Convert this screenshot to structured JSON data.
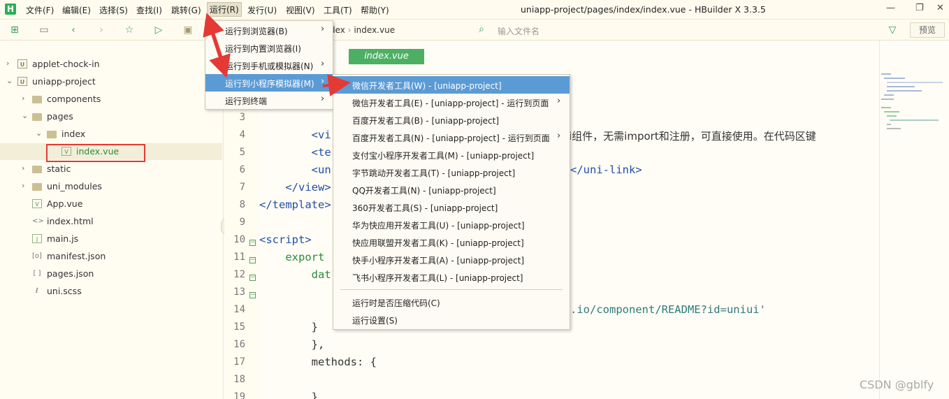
{
  "app": {
    "logo": "H",
    "window_title": "uniapp-project/pages/index/index.vue - HBuilder X 3.3.5"
  },
  "menubar": {
    "items": [
      "文件(F)",
      "编辑(E)",
      "选择(S)",
      "查找(I)",
      "跳转(G)",
      "运行(R)",
      "发行(U)",
      "视图(V)",
      "工具(T)",
      "帮助(Y)"
    ],
    "active": "运行(R)"
  },
  "window_controls": {
    "minimize": "—",
    "maximize": "❐",
    "close": "✕"
  },
  "toolbar": {
    "breadcrumb": [
      "dex",
      "index.vue"
    ],
    "search_placeholder": "输入文件名",
    "preview_label": "预览"
  },
  "sidebar": {
    "items": [
      {
        "label": "applet-chock-in",
        "type": "project",
        "expanded": false
      },
      {
        "label": "uniapp-project",
        "type": "project",
        "expanded": true
      },
      {
        "label": "components",
        "type": "folder",
        "expanded": false
      },
      {
        "label": "pages",
        "type": "folder",
        "expanded": true
      },
      {
        "label": "index",
        "type": "folder",
        "expanded": true
      },
      {
        "label": "index.vue",
        "type": "vue",
        "selected": true
      },
      {
        "label": "static",
        "type": "folder",
        "expanded": false
      },
      {
        "label": "uni_modules",
        "type": "folder",
        "expanded": false
      },
      {
        "label": "App.vue",
        "type": "vue"
      },
      {
        "label": "index.html",
        "type": "code"
      },
      {
        "label": "main.js",
        "type": "js"
      },
      {
        "label": "manifest.json",
        "type": "json"
      },
      {
        "label": "pages.json",
        "type": "json"
      },
      {
        "label": "uni.scss",
        "type": "scss"
      }
    ]
  },
  "editor": {
    "tab_label": "index.vue",
    "line_numbers": [
      "3",
      "4",
      "5",
      "6",
      "7",
      "8",
      "9",
      "10",
      "11",
      "12",
      "13",
      "14",
      "15",
      "16",
      "17",
      "18",
      "19"
    ],
    "lines": [
      "",
      "        <vi",
      "        <te",
      "        <un",
      "    </view>",
      "</template>",
      "",
      "<script>",
      "    export",
      "        dat",
      "",
      "",
      "        }",
      "        },",
      "        methods: {",
      "",
      "        }"
    ],
    "tail_line4": "i组件，无需import和注册，可直接使用。在代码区键",
    "tail_line6": "</uni-link>",
    "tail_line14": ".io/component/README?id=uniui'"
  },
  "run_menu": {
    "items": [
      {
        "label": "运行到浏览器(B)",
        "submenu": true
      },
      {
        "label": "运行到内置浏览器(I)",
        "submenu": false
      },
      {
        "label": "运行到手机或模拟器(N)",
        "submenu": true
      },
      {
        "label": "运行到小程序模拟器(M)",
        "submenu": true,
        "highlighted": true
      },
      {
        "label": "运行到终端",
        "submenu": true
      }
    ]
  },
  "miniprogram_menu": {
    "items": [
      {
        "label": "微信开发者工具(W) - [uniapp-project]",
        "highlighted": true
      },
      {
        "label": "微信开发者工具(E) - [uniapp-project] - 运行到页面",
        "submenu": true
      },
      {
        "label": "百度开发者工具(B) - [uniapp-project]"
      },
      {
        "label": "百度开发者工具(N) - [uniapp-project] - 运行到页面",
        "submenu": true
      },
      {
        "label": "支付宝小程序开发者工具(M) - [uniapp-project]"
      },
      {
        "label": "字节跳动开发者工具(T) - [uniapp-project]"
      },
      {
        "label": "QQ开发者工具(N) - [uniapp-project]"
      },
      {
        "label": "360开发者工具(S) - [uniapp-project]"
      },
      {
        "label": "华为快应用开发者工具(U) - [uniapp-project]"
      },
      {
        "label": "快应用联盟开发者工具(K) - [uniapp-project]"
      },
      {
        "label": "快手小程序开发者工具(A) - [uniapp-project]"
      },
      {
        "label": "飞书小程序开发者工具(L) - [uniapp-project]"
      }
    ],
    "footer_items": [
      {
        "label": "运行时是否压缩代码(C)"
      },
      {
        "label": "运行设置(S)"
      }
    ]
  },
  "watermark": "CSDN @gblfy",
  "colors": {
    "accent_green": "#4caf63",
    "highlight_blue": "#5b9bd5",
    "annotation_red": "#e53935"
  }
}
